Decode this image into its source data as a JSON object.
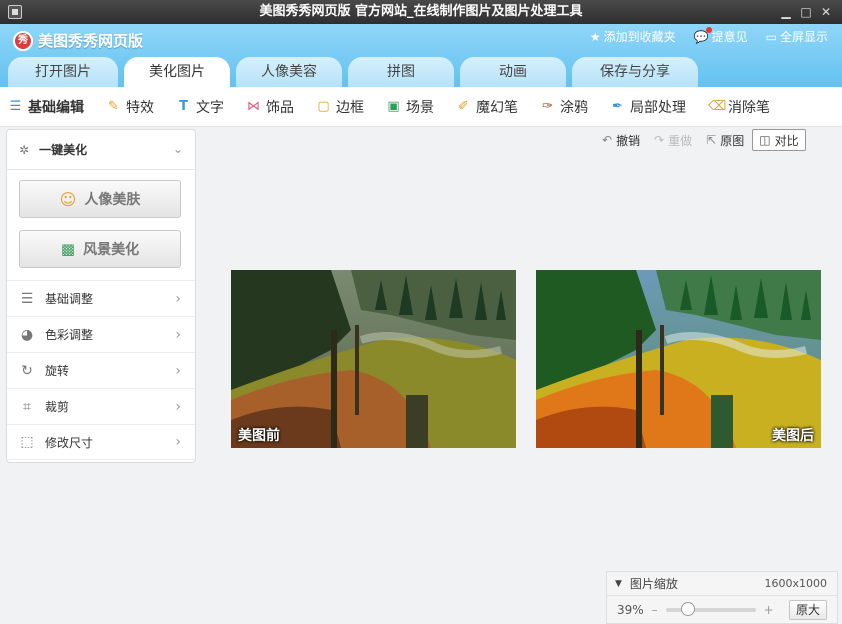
{
  "window": {
    "title": "美图秀秀网页版 官方网站_在线制作图片及图片处理工具"
  },
  "app": {
    "name": "美图秀秀网页版"
  },
  "top_links": [
    {
      "icon": "star-icon",
      "label": "添加到收藏夹"
    },
    {
      "icon": "feedback-icon",
      "label": "提意见"
    },
    {
      "icon": "fullscreen-icon",
      "label": "全屏显示"
    }
  ],
  "tabs": [
    {
      "label": "打开图片",
      "active": false
    },
    {
      "label": "美化图片",
      "active": true
    },
    {
      "label": "人像美容",
      "active": false
    },
    {
      "label": "拼图",
      "active": false
    },
    {
      "label": "动画",
      "active": false
    },
    {
      "label": "保存与分享",
      "active": false
    }
  ],
  "tools": [
    {
      "icon": "basic-edit-icon",
      "label": "基础编辑",
      "active": true
    },
    {
      "icon": "effects-icon",
      "label": "特效"
    },
    {
      "icon": "text-icon",
      "label": "文字"
    },
    {
      "icon": "ornament-icon",
      "label": "饰品"
    },
    {
      "icon": "frame-icon",
      "label": "边框"
    },
    {
      "icon": "scene-icon",
      "label": "场景"
    },
    {
      "icon": "magic-pen-icon",
      "label": "魔幻笔"
    },
    {
      "icon": "graffiti-icon",
      "label": "涂鸦"
    },
    {
      "icon": "local-process-icon",
      "label": "局部处理"
    },
    {
      "icon": "eraser-icon",
      "label": "消除笔"
    }
  ],
  "left_panel": {
    "oneclick_label": "一键美化",
    "portrait_btn": "人像美肤",
    "scenery_btn": "风景美化",
    "adjust_items": [
      {
        "icon": "sliders-icon",
        "label": "基础调整"
      },
      {
        "icon": "palette-icon",
        "label": "色彩调整"
      },
      {
        "icon": "rotate-icon",
        "label": "旋转"
      },
      {
        "icon": "crop-icon",
        "label": "裁剪"
      },
      {
        "icon": "resize-icon",
        "label": "修改尺寸"
      }
    ]
  },
  "edit_bar": {
    "undo": "撤销",
    "redo": "重做",
    "original": "原图",
    "compare": "对比"
  },
  "photos": {
    "before_label": "美图前",
    "after_label": "美图后"
  },
  "zoom": {
    "title": "图片缩放",
    "dimensions": "1600x1000",
    "percent": "39%",
    "level": 0.2,
    "minus": "–",
    "plus": "+",
    "original_size_btn": "原大"
  }
}
